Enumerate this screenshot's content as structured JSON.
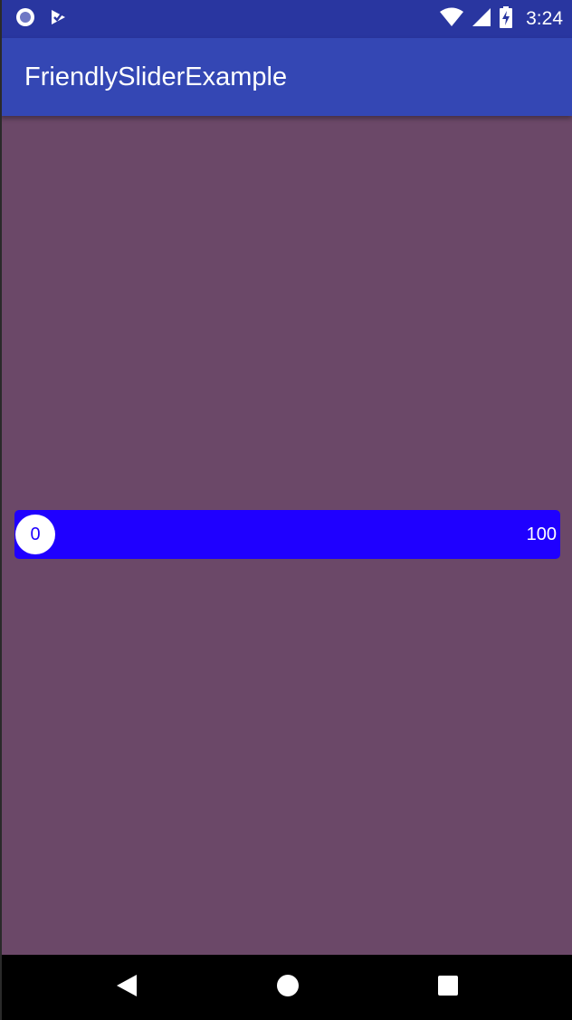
{
  "status_bar": {
    "time": "3:24",
    "left_icons": [
      "notification-circle-icon",
      "notification-check-icon"
    ],
    "right_icons": [
      "wifi-icon",
      "cell-signal-icon",
      "battery-charging-icon"
    ]
  },
  "app_bar": {
    "title": "FriendlySliderExample"
  },
  "slider": {
    "current_value": "0",
    "max_value": "100",
    "fraction": 0.0
  },
  "nav_bar": {
    "buttons": [
      "back-icon",
      "home-icon",
      "recents-icon"
    ]
  },
  "colors": {
    "background": "#6b4868",
    "status_bar": "#2936a0",
    "app_bar": "#3447b4",
    "slider_track": "#1f00ff",
    "slider_thumb": "#ffffff"
  }
}
